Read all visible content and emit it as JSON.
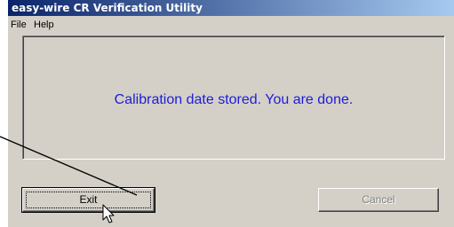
{
  "window": {
    "title": "easy-wire CR Verification Utility"
  },
  "menu": {
    "file": "File",
    "help": "Help"
  },
  "panel": {
    "message": "Calibration date stored.  You are done."
  },
  "buttons": {
    "exit": "Exit",
    "cancel": "Cancel"
  },
  "colors": {
    "title_bar": "#0a246a",
    "message_text": "#1c1cdc",
    "window_face": "#d4d0c8",
    "disabled_text": "#808080"
  },
  "icons": {
    "pointer": "mouse-pointer-icon",
    "annotation": "annotation-arrow"
  }
}
